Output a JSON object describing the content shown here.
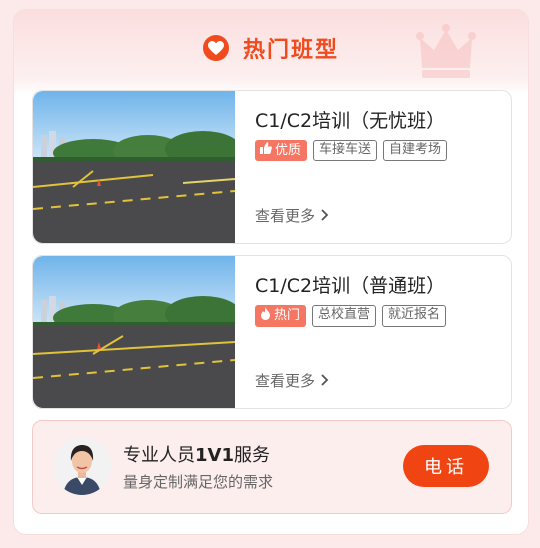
{
  "section": {
    "title": "热门班型",
    "accent": "#f04b1e"
  },
  "courses": [
    {
      "title": "C1/C2培训（无忧班）",
      "badge": "优质",
      "badge_icon": "thumbs-up-icon",
      "tags": [
        "车接车送",
        "自建考场"
      ],
      "more": "查看更多"
    },
    {
      "title": "C1/C2培训（普通班）",
      "badge": "热门",
      "badge_icon": "flame-icon",
      "tags": [
        "总校直营",
        "就近报名"
      ],
      "more": "查看更多"
    }
  ],
  "contact": {
    "title_prefix": "专业人员",
    "title_bold": "1V1",
    "title_suffix": "服务",
    "subtitle": "量身定制满足您的需求",
    "button": "电话",
    "button_color": "#f04513"
  }
}
